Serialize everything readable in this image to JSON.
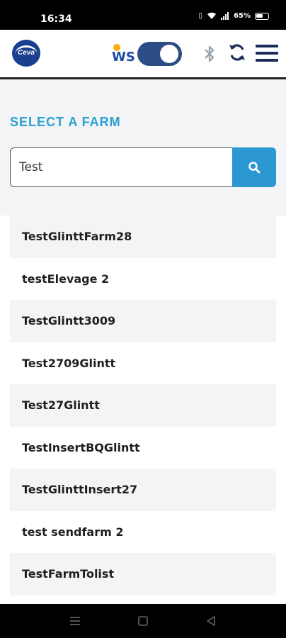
{
  "status_bar": {
    "time": "16:34",
    "battery": "65%"
  },
  "header": {
    "logo_text": "Ceva",
    "ws_label": "WS"
  },
  "page": {
    "title": "SELECT A FARM"
  },
  "search": {
    "value": "Test"
  },
  "farms": [
    "TestGlinttFarm28",
    "testElevage 2",
    "TestGlintt3009",
    "Test2709Glintt",
    "Test27Glintt",
    "TestInsertBQGlintt",
    "TestGlinttInsert27",
    "test sendfarm 2",
    "TestFarmTolist"
  ],
  "colors": {
    "accent": "#2aa0d2",
    "search_button": "#2a96d2",
    "toggle": "#2c4c86",
    "brand_blue": "#1a3f8e"
  },
  "icons": {
    "search": "search-icon",
    "bluetooth": "bluetooth-icon",
    "sync": "sync-icon",
    "menu": "hamburger-menu-icon"
  }
}
